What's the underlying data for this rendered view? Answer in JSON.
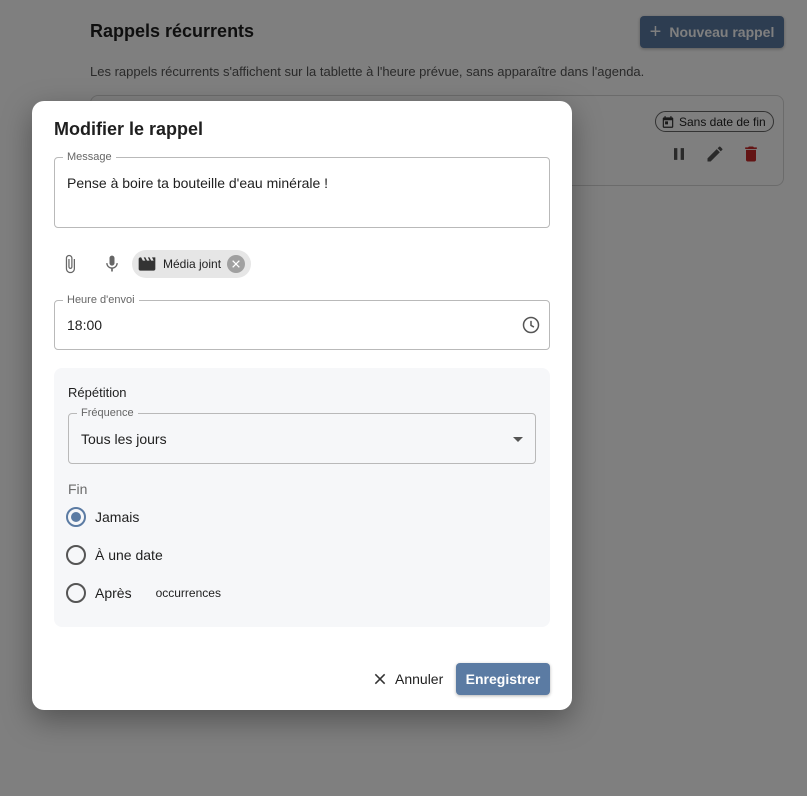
{
  "background": {
    "title": "Rappels récurrents",
    "new_button_label": "Nouveau rappel",
    "subtitle": "Les rappels récurrents s'affichent sur la tablette à l'heure prévue, sans apparaître dans l'agenda.",
    "card": {
      "end_chip_label": "Sans date de fin"
    }
  },
  "dialog": {
    "title": "Modifier le rappel",
    "message": {
      "label": "Message",
      "value": "Pense à boire ta bouteille d'eau minérale !"
    },
    "media_chip_label": "Média joint",
    "send_time": {
      "label": "Heure d'envoi",
      "value": "18:00"
    },
    "repetition": {
      "title": "Répétition",
      "frequency": {
        "label": "Fréquence",
        "value": "Tous les jours"
      },
      "end_label": "Fin",
      "options": {
        "never": "Jamais",
        "on_date": "À une date",
        "after": "Après",
        "occurrences": "occurrences"
      },
      "selected": "never"
    },
    "cancel_label": "Annuler",
    "save_label": "Enregistrer"
  },
  "colors": {
    "accent": "#5b7ba3",
    "delete": "#c62828",
    "overlay": "rgba(0,0,0,0.5)"
  }
}
